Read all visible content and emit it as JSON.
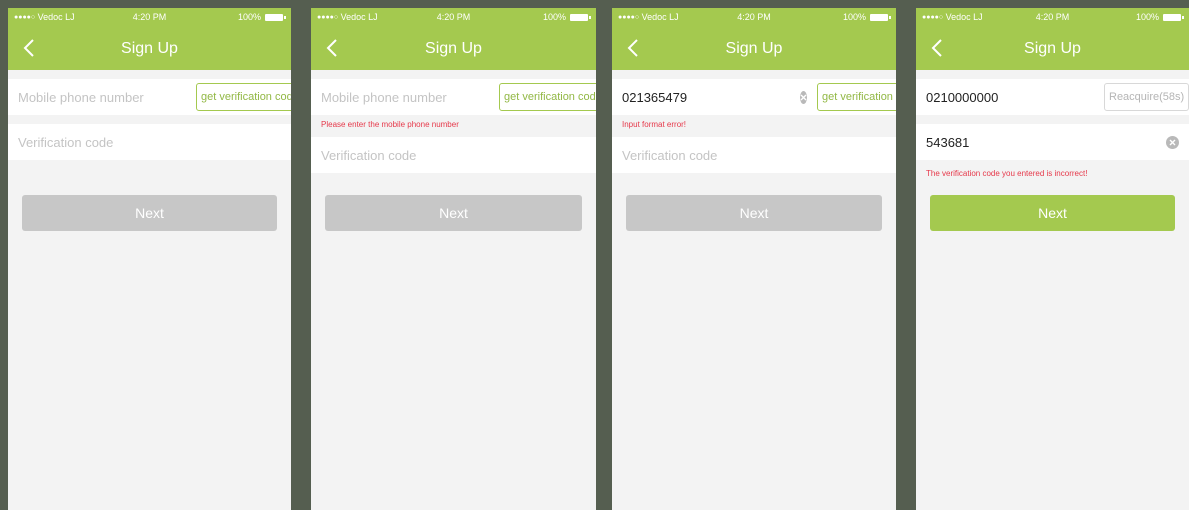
{
  "status_bar": {
    "carrier": "Vedoc LJ",
    "time": "4:20 PM",
    "battery": "100%"
  },
  "nav": {
    "title": "Sign Up"
  },
  "phone_placeholder": "Mobile phone number",
  "code_placeholder": "Verification code",
  "get_code_label": "get verification code",
  "next_label": "Next",
  "screens": [
    {},
    {
      "error_phone": "Please enter the mobile phone number"
    },
    {
      "phone_value": "021365479",
      "error_phone": "Input format error!"
    },
    {
      "phone_value": "0210000000",
      "reacquire_label": "Reacquire(58s)",
      "code_value": "543681",
      "error_code": "The verification code you entered is incorrect!"
    }
  ],
  "colors": {
    "accent": "#a4c94f",
    "disabled": "#c7c7c7",
    "error": "#e6384a"
  }
}
